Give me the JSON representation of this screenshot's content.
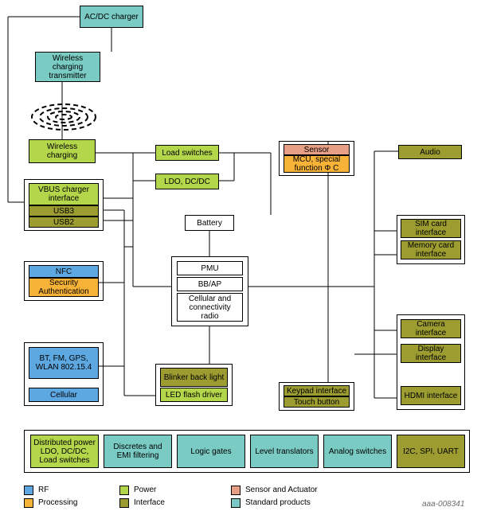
{
  "doc_id": "aaa-008341",
  "legend": {
    "rf": "RF",
    "proc": "Processing",
    "pwr": "Power",
    "if": "Interface",
    "sa": "Sensor and Actuator",
    "std": "Standard products"
  },
  "blocks": {
    "acdc": "AC/DC charger",
    "wct": "Wireless charging transmitter",
    "wc": "Wireless charging",
    "vbus": "VBUS charger interface",
    "usb3": "USB3",
    "usb2": "USB2",
    "load": "Load switches",
    "ldo": "LDO, DC/DC",
    "battery": "Battery",
    "pmu": "PMU",
    "bbap": "BB/AP",
    "radio": "Cellular and connectivity radio",
    "nfc": "NFC",
    "sec": "Security Authentication",
    "bt": "BT, FM, GPS, WLAN 802.15.4",
    "cell": "Cellular",
    "blinker": "Blinker back light",
    "led": "LED flash driver",
    "sensor": "Sensor",
    "mcu": "MCU, special function Φ C",
    "keypad": "Keypad interface",
    "touch": "Touch button",
    "audio": "Audio",
    "sim": "SIM card interface",
    "mem": "Memory card interface",
    "cam": "Camera interface",
    "disp": "Display interface",
    "hdmi": "HDMI interface",
    "distp": "Distributed power LDO, DC/DC, Load switches",
    "emi": "Discretes and EMI filtering",
    "logic": "Logic gates",
    "level": "Level translators",
    "analog": "Analog switches",
    "i2c": "I2C, SPI, UART"
  }
}
